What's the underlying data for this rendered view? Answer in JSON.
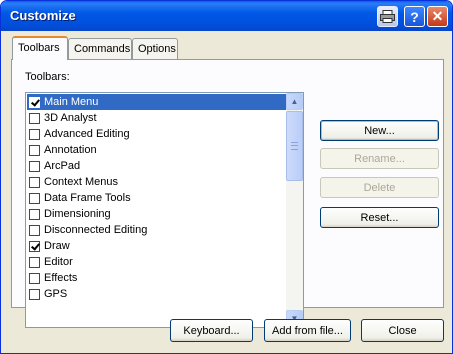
{
  "window": {
    "title": "Customize",
    "title_icons": [
      "printer-icon",
      "help-icon",
      "close-icon"
    ],
    "help_glyph": "?",
    "close_glyph": "✕"
  },
  "tabs": [
    {
      "label": "Toolbars",
      "active": true
    },
    {
      "label": "Commands",
      "active": false
    },
    {
      "label": "Options",
      "active": false
    }
  ],
  "toolbars_panel": {
    "group_label": "Toolbars:",
    "items": [
      {
        "label": "Main Menu",
        "checked": true,
        "selected": true
      },
      {
        "label": "3D Analyst",
        "checked": false,
        "selected": false
      },
      {
        "label": "Advanced Editing",
        "checked": false,
        "selected": false
      },
      {
        "label": "Annotation",
        "checked": false,
        "selected": false
      },
      {
        "label": "ArcPad",
        "checked": false,
        "selected": false
      },
      {
        "label": "Context Menus",
        "checked": false,
        "selected": false
      },
      {
        "label": "Data Frame Tools",
        "checked": false,
        "selected": false
      },
      {
        "label": "Dimensioning",
        "checked": false,
        "selected": false
      },
      {
        "label": "Disconnected Editing",
        "checked": false,
        "selected": false
      },
      {
        "label": "Draw",
        "checked": true,
        "selected": false
      },
      {
        "label": "Editor",
        "checked": false,
        "selected": false
      },
      {
        "label": "Effects",
        "checked": false,
        "selected": false
      },
      {
        "label": "GPS",
        "checked": false,
        "selected": false
      }
    ],
    "buttons": {
      "new": "New...",
      "rename": "Rename...",
      "delete": "Delete",
      "reset": "Reset..."
    }
  },
  "footer": {
    "keyboard": "Keyboard...",
    "add_from_file": "Add from file...",
    "close": "Close"
  },
  "colors": {
    "titlebar": "#0058e6",
    "selection": "#316ac5",
    "active_tab_accent": "#e68b2c"
  }
}
